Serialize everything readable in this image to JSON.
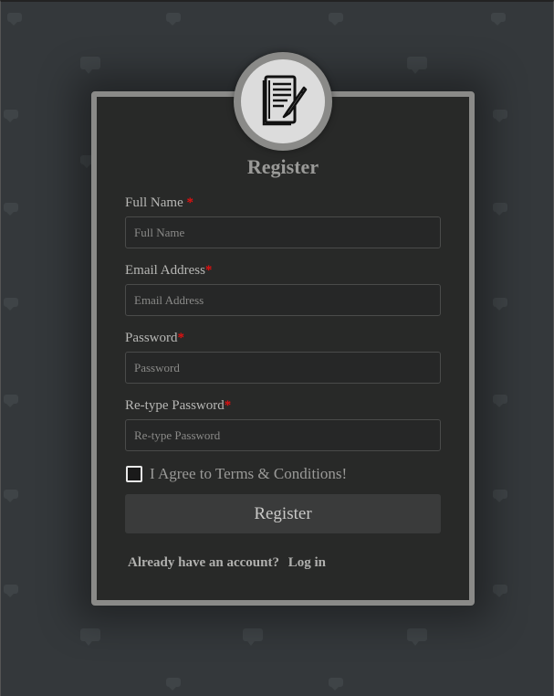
{
  "form": {
    "title": "Register",
    "fields": [
      {
        "label": "Full Name",
        "required_mark": "*",
        "placeholder": "Full Name"
      },
      {
        "label": "Email Address",
        "required_mark": "*",
        "placeholder": "Email Address"
      },
      {
        "label": "Password",
        "required_mark": "*",
        "placeholder": "Password"
      },
      {
        "label": "Re-type Password",
        "required_mark": "*",
        "placeholder": "Re-type Password"
      }
    ],
    "agree_text": "I Agree to Terms & Conditions!",
    "submit_label": "Register",
    "login_prompt": "Already have an account?",
    "login_link": "Log in"
  },
  "icons": {
    "avatar": "document-pen-icon",
    "checkbox": "checkbox-unchecked-icon"
  },
  "colors": {
    "background": "#34383b",
    "card": "#282928",
    "card_border": "#8a8a88",
    "required": "#e01010",
    "button": "#3a3b3b"
  }
}
